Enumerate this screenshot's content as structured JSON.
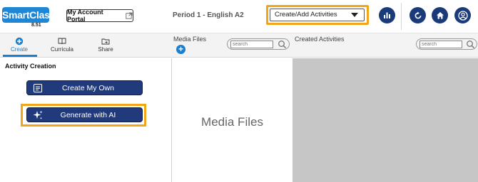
{
  "header": {
    "logo_text": "SmartClass",
    "logo_reg": "®",
    "logo_version": "8.51",
    "account_button": "My Account Portal",
    "period_title": "Period 1 - English A2",
    "activity_select": "Create/Add Activities",
    "icons": [
      "chart-icon",
      "refresh-icon",
      "home-icon",
      "user-icon"
    ]
  },
  "tabs": [
    {
      "label": "Create",
      "icon": "plus-circle-icon",
      "active": true
    },
    {
      "label": "Curricula",
      "icon": "book-icon",
      "active": false
    },
    {
      "label": "Share",
      "icon": "share-icon",
      "active": false
    }
  ],
  "media": {
    "label": "Media Files",
    "search_placeholder": "search",
    "placeholder_text": "Media Files"
  },
  "created": {
    "label": "Created Activities",
    "search_placeholder": "search"
  },
  "activity_creation": {
    "title": "Activity Creation",
    "create_own": "Create My Own",
    "generate_ai": "Generate with AI"
  },
  "colors": {
    "brand_blue": "#1f86d6",
    "navy": "#203a7c",
    "highlight": "#f2a516",
    "panel_gray": "#c6c6c6"
  }
}
